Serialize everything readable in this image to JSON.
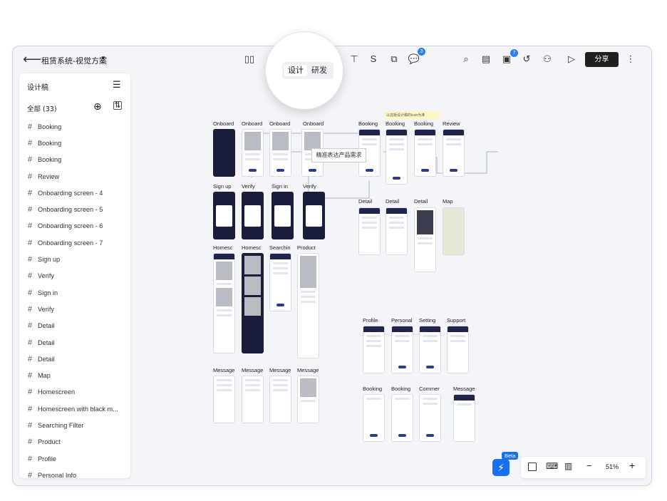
{
  "header": {
    "doc_title": "租赁系统-视觉方案",
    "share_label": "分享",
    "comment_badge": "3",
    "notif_badge": "7"
  },
  "mode_switch": {
    "design": "设计",
    "dev": "研发"
  },
  "sidebar": {
    "title": "设计稿",
    "all_label": "全部 (33)",
    "items": [
      "Booking",
      "Booking",
      "Booking",
      "Review",
      "Onboarding screen - 4",
      "Onboarding screen - 5",
      "Onboarding screen - 6",
      "Onboarding screen - 7",
      "Sign up",
      "Verify",
      "Sign in",
      "Verify",
      "Detail",
      "Detail",
      "Detail",
      "Map",
      "Homescreen",
      "Homescreen with black m...",
      "Searching Filter",
      "Product",
      "Profile",
      "Personal Info"
    ]
  },
  "canvas": {
    "tooltip": "精准表达产品需求",
    "sticky_note": "以这版设计稿的icon为准",
    "labels": {
      "onboard1": "Onboard",
      "onboard2": "Onboard",
      "onboard3": "Onboard",
      "onboard4": "Onboard",
      "signup": "Sign up",
      "verify1": "Verify",
      "signin": "Sign in",
      "verify2": "Verify",
      "home1": "Homesc",
      "home2": "Homesc",
      "searching": "Searchin",
      "product": "Product",
      "msg1": "Message",
      "msg2": "Message",
      "msg3": "Message",
      "msg4": "Message",
      "booking1": "Booking",
      "booking2": "Booking",
      "booking3": "Booking",
      "review": "Review",
      "detail1": "Detail",
      "detail2": "Detail",
      "detail3": "Detail",
      "map": "Map",
      "profile": "Profile",
      "personal": "Personal",
      "setting": "Setting",
      "support": "Support",
      "booking4": "Booking",
      "booking5": "Booking",
      "commer": "Commer",
      "msg5": "Message"
    }
  },
  "zoom": {
    "level": "51%",
    "beta": "Beta"
  }
}
